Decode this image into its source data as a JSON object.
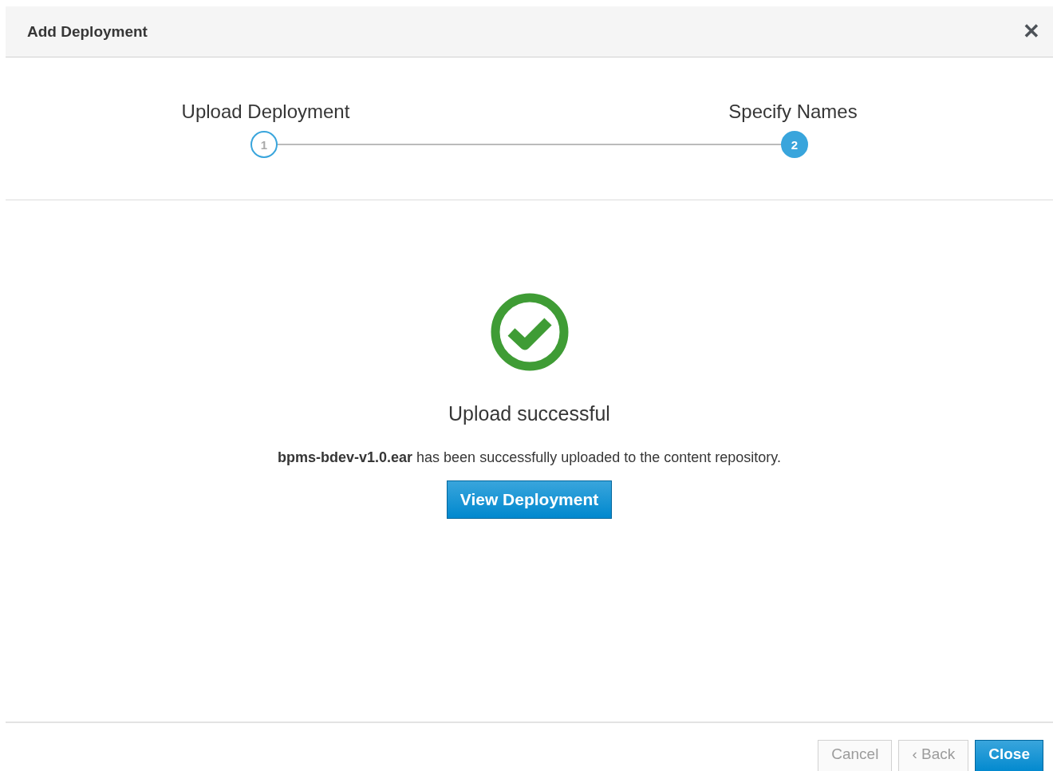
{
  "dialog": {
    "title": "Add Deployment",
    "close_label": "✕"
  },
  "steps": [
    {
      "label": "Upload Deployment",
      "number": "1",
      "selected": false
    },
    {
      "label": "Specify Names",
      "number": "2",
      "selected": true
    }
  ],
  "result": {
    "heading": "Upload successful",
    "message": "**bpms-bdev-v1.0.ear** has been successfully uploaded to the content repository.",
    "action": "View Deployment"
  },
  "buttons": [
    {
      "label": "Cancel",
      "kind": "default",
      "disabled": true
    },
    {
      "label": "‹ Back",
      "kind": "default",
      "disabled": true
    },
    {
      "label": "Close",
      "kind": "primary",
      "disabled": false
    }
  ]
}
